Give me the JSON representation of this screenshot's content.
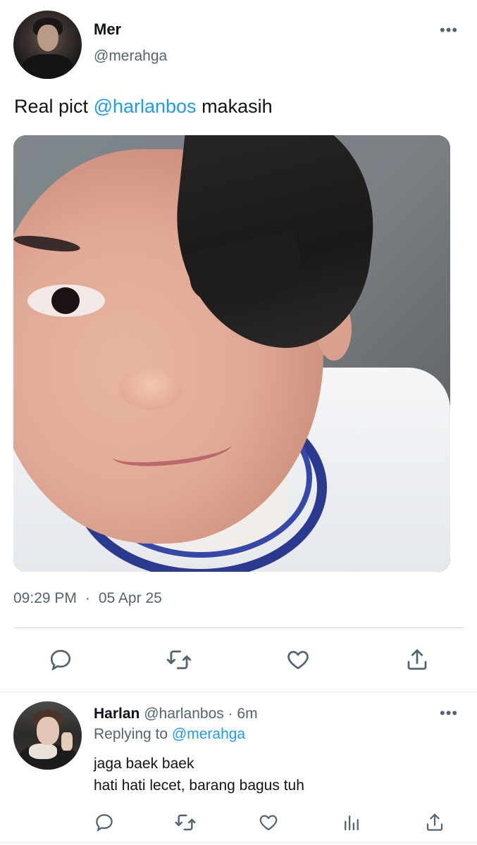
{
  "tweet": {
    "author_name": "Mer",
    "author_handle": "@merahga",
    "text_before": "Real pict ",
    "text_mention": "@harlanbos",
    "text_after": " makasih",
    "time": "09:29 PM",
    "separator": "·",
    "date": "05 Apr 25",
    "more_label": "•••"
  },
  "reply": {
    "author_name": "Harlan",
    "author_handle": "@harlanbos",
    "age": "· 6m",
    "replying_prefix": "Replying to ",
    "replying_to": "@merahga",
    "line1": "jaga baek baek",
    "line2": "hati hati lecet, barang bagus tuh",
    "more_label": "•••"
  },
  "icons": {
    "main_actions": [
      "reply-icon",
      "retweet-icon",
      "like-icon",
      "share-icon"
    ],
    "reply_actions": [
      "reply-icon",
      "retweet-icon",
      "like-icon",
      "analytics-icon",
      "share-icon"
    ]
  },
  "colors": {
    "link": "#1d9bf0",
    "secondary_text": "#536471",
    "primary_text": "#0f1419"
  }
}
